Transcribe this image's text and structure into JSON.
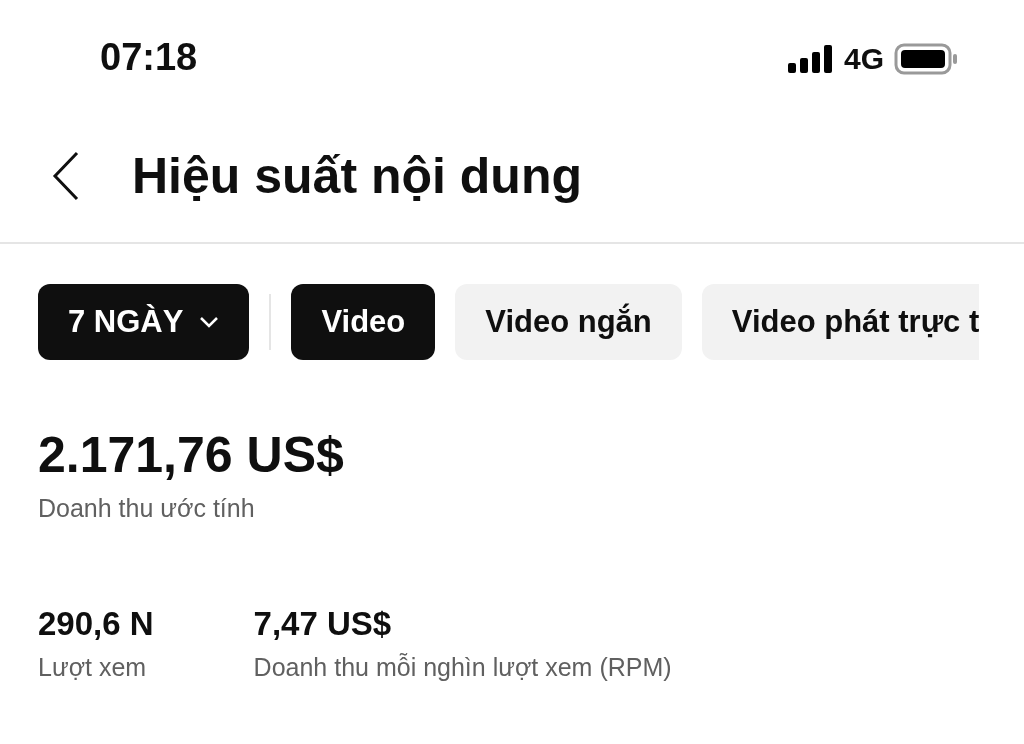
{
  "status_bar": {
    "time": "07:18",
    "network": "4G"
  },
  "header": {
    "title": "Hiệu suất nội dung"
  },
  "period": {
    "label": "7 NGÀY"
  },
  "tabs": [
    {
      "label": "Video",
      "selected": true
    },
    {
      "label": "Video ngắn",
      "selected": false
    },
    {
      "label": "Video phát trực t",
      "selected": false
    }
  ],
  "revenue": {
    "value": "2.171,76 US$",
    "label": "Doanh thu ước tính"
  },
  "stats": [
    {
      "value": "290,6 N",
      "label": "Lượt xem"
    },
    {
      "value": "7,47 US$",
      "label": "Doanh thu mỗi nghìn lượt xem (RPM)"
    }
  ]
}
